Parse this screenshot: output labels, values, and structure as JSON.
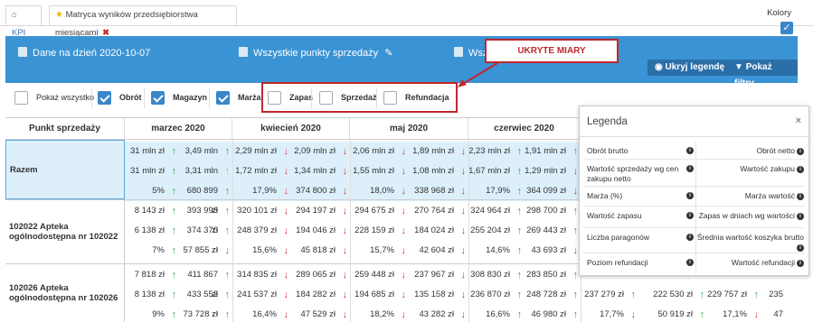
{
  "tabs": {
    "kpi_label": "KPI",
    "active_label": "Matryca wyników przedsiębiorstwa miesiącami"
  },
  "kolory": {
    "label": "Kolory"
  },
  "header": {
    "date": "Dane na dzień 2020-10-07",
    "stores": "Wszystkie punkty sprzedaży",
    "partial": "Wsz",
    "hide_legend": "Ukryj legendę",
    "show_filters": "Pokaż filtry"
  },
  "annotation": {
    "label": "UKRYTE MIARY"
  },
  "measures": {
    "show_all": "Pokaż wszystko",
    "items": [
      {
        "label": "Obrót",
        "checked": true
      },
      {
        "label": "Magazyn",
        "checked": true
      },
      {
        "label": "Marża",
        "checked": true
      },
      {
        "label": "Zapas",
        "checked": false
      },
      {
        "label": "Sprzedaż",
        "checked": false
      },
      {
        "label": "Refundacja",
        "checked": false
      }
    ]
  },
  "table": {
    "first_col": "Punkt sprzedaży",
    "months": [
      "marzec 2020",
      "kwiecień 2020",
      "maj 2020",
      "czerwiec 2020"
    ],
    "rows": [
      {
        "label": "Razem",
        "cells": [
          [
            "31 mln zł",
            "3,49 mln zł",
            "2,29 mln zł",
            "2,09 mln zł",
            "2,06 mln zł",
            "1,89 mln zł",
            "2,23 mln zł",
            "1,91 mln zł"
          ],
          [
            "31 mln zł",
            "3,31 mln zł",
            "1,72 mln zł",
            "1,34 mln zł",
            "1,55 mln zł",
            "1,08 mln zł",
            "1,67 mln zł",
            "1,29 mln zł"
          ],
          [
            "5%",
            "680 899 zł",
            "17,9%",
            "374 800 zł",
            "18,0%",
            "338 968 zł",
            "17,9%",
            "364 099 zł"
          ]
        ]
      },
      {
        "label": "102022 Apteka ogólnodostępna nr 102022",
        "cells": [
          [
            "8 143 zł",
            "393 993 zł",
            "320 101 zł",
            "294 197 zł",
            "294 675 zł",
            "270 764 zł",
            "324 964 zł",
            "298 700 zł"
          ],
          [
            "6 138 zł",
            "374 370 zł",
            "248 379 zł",
            "194 046 zł",
            "228 159 zł",
            "184 024 zł",
            "255 204 zł",
            "269 443 zł"
          ],
          [
            "7%",
            "57 855 zł",
            "15,6%",
            "45 818 zł",
            "15,7%",
            "42 604 zł",
            "14,6%",
            "43 693 zł"
          ]
        ]
      },
      {
        "label": "102026 Apteka ogólnodostępna nr 102026",
        "cells": [
          [
            "7 818 zł",
            "411 867 zł",
            "314 835 zł",
            "289 065 zł",
            "259 448 zł",
            "237 967 zł",
            "308 830 zł",
            "283 850 zł"
          ],
          [
            "8 138 zł",
            "433 552 zł",
            "241 537 zł",
            "184 282 zł",
            "194 685 zł",
            "135 158 zł",
            "236 870 zł",
            "248 728 zł"
          ],
          [
            "9%",
            "73 728 zł",
            "16,4%",
            "47 529 zł",
            "18,2%",
            "43 282 zł",
            "16,6%",
            "46 980 zł"
          ]
        ]
      }
    ],
    "extra": [
      "237 279 zł",
      "222 530 zł",
      "229 757 zł",
      "235",
      "17,7%",
      "50 919 zł",
      "17,1%",
      "47"
    ]
  },
  "legend": {
    "title": "Legenda",
    "close": "×",
    "rows": [
      [
        "Obrót brutto",
        "Obrót netto"
      ],
      [
        "Wartość sprzedaży wg cen zakupu netto",
        "Wartość zakupu"
      ],
      [
        "Marża (%)",
        "Marża wartość"
      ],
      [
        "Wartość zapasu",
        "Zapas w dniach wg wartości"
      ],
      [
        "Liczba paragonów",
        "Średnia wartość koszyka brutto"
      ],
      [
        "Poziom refundacji",
        "Wartość refundacji"
      ]
    ]
  },
  "colors": {
    "accent": "#3a93d4",
    "annotation": "#c0282d",
    "total_bg": "#dceffb"
  }
}
